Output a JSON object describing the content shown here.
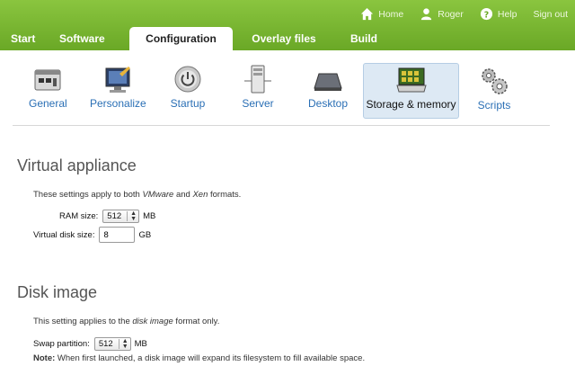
{
  "colors": {
    "header_green": "#7ab833",
    "link_blue": "#2a6fb5",
    "selected_bg": "#dde9f4"
  },
  "userlinks": [
    {
      "label": "Home",
      "icon": "home-icon"
    },
    {
      "label": "Roger",
      "icon": "user-icon"
    },
    {
      "label": "Help",
      "icon": "help-icon"
    },
    {
      "label": "Sign out"
    }
  ],
  "tabs": [
    "Start",
    "Software",
    "Configuration",
    "Overlay files",
    "Build"
  ],
  "active_tab": "Configuration",
  "subnav": [
    {
      "label": "General",
      "icon": "general-window-icon"
    },
    {
      "label": "Personalize",
      "icon": "personalize-monitor-icon"
    },
    {
      "label": "Startup",
      "icon": "power-icon"
    },
    {
      "label": "Server",
      "icon": "server-tower-icon"
    },
    {
      "label": "Desktop",
      "icon": "desktop-icon"
    },
    {
      "label": "Storage & memory",
      "icon": "memory-chip-icon"
    },
    {
      "label": "Scripts",
      "icon": "gears-icon"
    }
  ],
  "selected_subnav": "Storage & memory",
  "virtual_appliance": {
    "title": "Virtual appliance",
    "desc_pre": "These settings apply to both ",
    "desc_a": "VMware",
    "desc_mid": " and ",
    "desc_b": "Xen",
    "desc_post": " formats.",
    "ram_label": "RAM size:",
    "ram_value": "512",
    "ram_unit": "MB",
    "disk_label": "Virtual disk size:",
    "disk_value": "8",
    "disk_unit": "GB"
  },
  "disk_image": {
    "title": "Disk image",
    "desc_pre": "This setting applies to the ",
    "desc_em": "disk image",
    "desc_post": " format only.",
    "swap_label": "Swap partition:",
    "swap_value": "512",
    "swap_unit": "MB",
    "note_label": "Note:",
    "note_text": " When first launched, a disk image will expand its filesystem to fill available space."
  }
}
